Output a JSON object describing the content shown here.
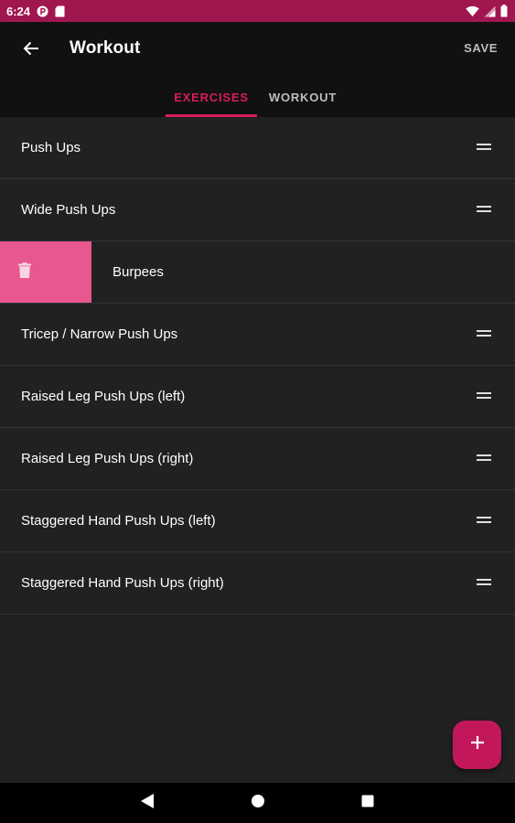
{
  "status_bar": {
    "time": "6:24",
    "icons": [
      "p-app-icon",
      "sd-card-icon",
      "wifi-icon",
      "signal-icon",
      "battery-icon"
    ]
  },
  "app_bar": {
    "back_icon": "arrow-left-icon",
    "title": "Workout",
    "save_label": "SAVE"
  },
  "tabs": [
    {
      "label": "EXERCISES",
      "selected": true
    },
    {
      "label": "WORKOUT",
      "selected": false
    }
  ],
  "exercises": [
    {
      "label": "Push Ups"
    },
    {
      "label": "Wide Push Ups"
    },
    {
      "label": "Burpees",
      "swiped_to_delete": true
    },
    {
      "label": "Tricep / Narrow Push Ups"
    },
    {
      "label": "Raised Leg Push Ups (left)"
    },
    {
      "label": "Raised Leg Push Ups (right)"
    },
    {
      "label": "Staggered Hand Push Ups (left)"
    },
    {
      "label": "Staggered Hand Push Ups (right)"
    }
  ],
  "fab": {
    "icon": "plus-icon"
  },
  "nav_bar": {
    "icons": [
      "back-triangle-icon",
      "home-circle-icon",
      "recents-square-icon"
    ]
  },
  "colors": {
    "status_bar": "#a0174f",
    "app_bar": "#111111",
    "background": "#212121",
    "accent": "#d81b60",
    "delete_bg": "#e8578f",
    "fab": "#c2185b"
  }
}
